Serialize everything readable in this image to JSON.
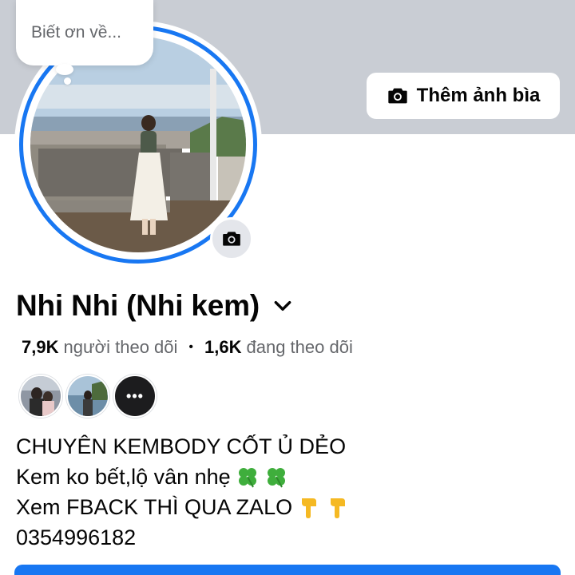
{
  "note": {
    "text": "Biết ơn về..."
  },
  "cover": {
    "add_cover_label": "Thêm ảnh bìa",
    "button_icon": "camera-icon"
  },
  "avatar": {
    "badge_icon": "camera-icon"
  },
  "profile": {
    "name": "Nhi Nhi (Nhi kem)",
    "dropdown_icon": "chevron-down-icon"
  },
  "stats": {
    "followers_count": "7,9K",
    "followers_label": "người theo dõi",
    "separator": "•",
    "following_count": "1,6K",
    "following_label": "đang theo dõi"
  },
  "friends": {
    "more_label": "•••"
  },
  "bio": {
    "line1": "CHUYÊN KEMBODY CỐT Ủ DẺO",
    "line2": "Kem ko bết,lộ vân nhẹ",
    "line2_emoji": "four-leaf-clover",
    "line3": "Xem FBACK THÌ QUA ZALO",
    "line3_emoji": "backhand-index-pointing-down",
    "line4": "0354996182"
  },
  "colors": {
    "accent": "#1877f2",
    "cover_bg": "#c9cdd4",
    "secondary_text": "#65676b"
  }
}
